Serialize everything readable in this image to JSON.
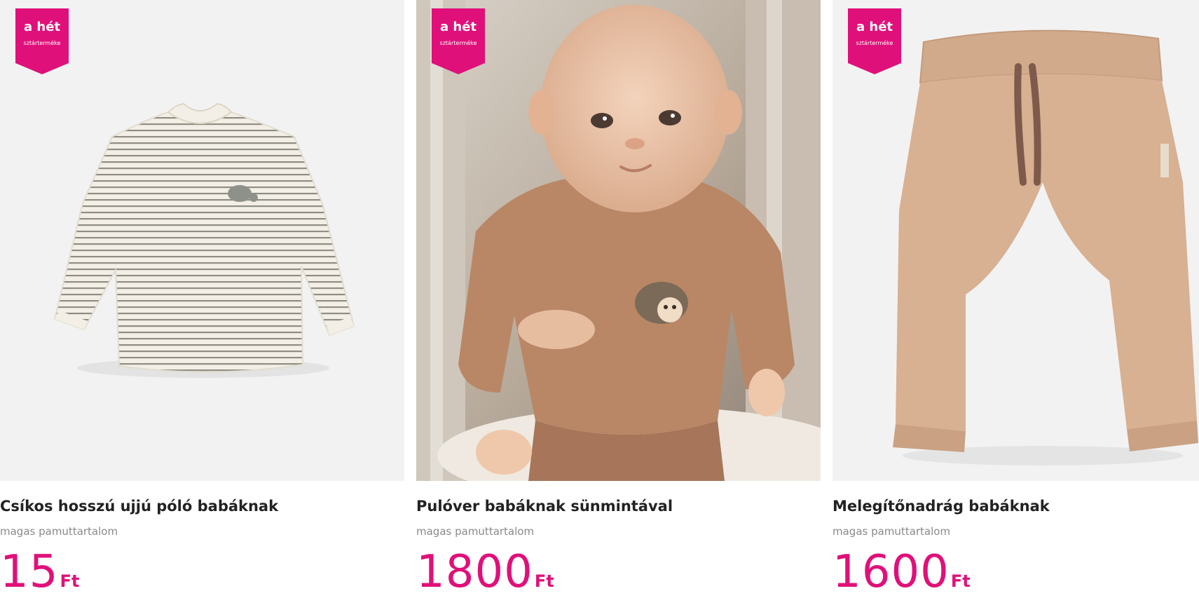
{
  "badge": {
    "title": "a hét",
    "subtitle": "sztárterméke",
    "color": "#e0107a"
  },
  "products": [
    {
      "title": "Csíkos hosszú ujjú póló babáknak",
      "subtitle": "magas pamuttartalom",
      "price": "15",
      "currency": "Ft",
      "image": "striped-long-sleeve-shirt"
    },
    {
      "title": "Pulóver babáknak sünmintával",
      "subtitle": "magas pamuttartalom",
      "price": "1800",
      "currency": "Ft",
      "image": "baby-in-hedgehog-sweater"
    },
    {
      "title": "Melegítőnadrág babáknak",
      "subtitle": "magas pamuttartalom",
      "price": "1600",
      "currency": "Ft",
      "image": "beige-sweatpants"
    }
  ],
  "colors": {
    "accent": "#e0107a",
    "title": "#222222",
    "subtitle": "#8a8a8a",
    "image_bg": "#f2f2f2"
  }
}
